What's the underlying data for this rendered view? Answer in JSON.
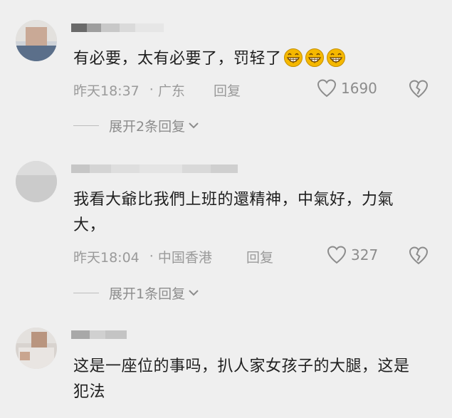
{
  "comments": [
    {
      "text": "有必要，太有必要了，罚轻了",
      "emoji_count": 3,
      "time": "昨天18:37",
      "location": "广东",
      "reply": "回复",
      "likes": "1690",
      "expand": "展开2条回复"
    },
    {
      "text": "我看大爺比我們上班的還精神，中氣好，力氣大，",
      "time": "昨天18:04",
      "location": "中国香港",
      "reply": "回复",
      "likes": "327",
      "expand": "展开1条回复"
    },
    {
      "text": "这是一座位的事吗，扒人家女孩子的大腿，这是犯法"
    }
  ],
  "colors": {
    "background": "#efefef",
    "meta": "#9a9a9a",
    "emoji": "#f5b800"
  },
  "icons": [
    "heart-outline-icon",
    "broken-heart-icon",
    "chevron-down-icon",
    "grin-emoji-icon"
  ]
}
